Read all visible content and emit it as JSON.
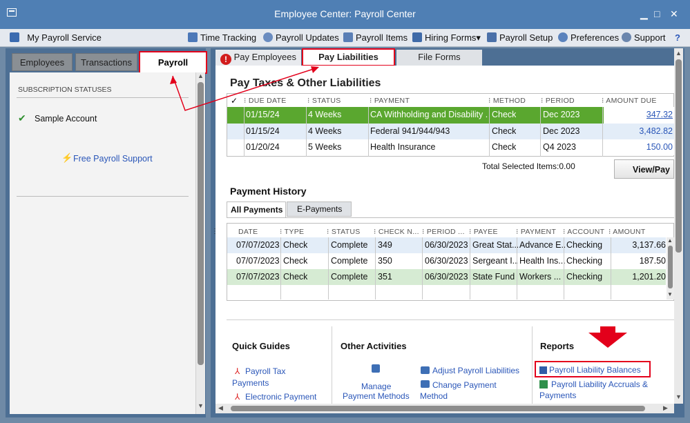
{
  "window": {
    "title": "Employee Center: Payroll Center",
    "min": "▁",
    "max": "□",
    "close": "✕"
  },
  "toolbar": {
    "my_payroll": "My Payroll Service",
    "time_tracking": "Time Tracking",
    "payroll_updates": "Payroll Updates",
    "payroll_items": "Payroll Items",
    "hiring_forms": "Hiring Forms▾",
    "payroll_setup": "Payroll Setup",
    "preferences": "Preferences",
    "support": "Support",
    "help": "?"
  },
  "left": {
    "tabs": [
      "Employees",
      "Transactions",
      "Payroll"
    ],
    "subscription_header": "SUBSCRIPTION STATUSES",
    "account": "Sample Account",
    "free_support": "Free Payroll Support"
  },
  "right": {
    "tabs": [
      "Pay Employees",
      "Pay Liabilities",
      "File Forms"
    ],
    "liabilities_title": "Pay Taxes & Other Liabilities",
    "liab_headers": [
      "✓",
      "DUE DATE",
      "STATUS",
      "PAYMENT",
      "METHOD",
      "PERIOD",
      "AMOUNT DUE"
    ],
    "liab_rows": [
      {
        "due": "01/15/24",
        "status": "4 Weeks",
        "payment": "CA Withholding and Disability ...",
        "method": "Check",
        "period": "Dec 2023",
        "amount": "347.32"
      },
      {
        "due": "01/15/24",
        "status": "4 Weeks",
        "payment": "Federal 941/944/943",
        "method": "Check",
        "period": "Dec 2023",
        "amount": "3,482.82"
      },
      {
        "due": "01/20/24",
        "status": "5 Weeks",
        "payment": "Health Insurance",
        "method": "Check",
        "period": "Q4 2023",
        "amount": "150.00"
      }
    ],
    "total_selected": "Total Selected Items:0.00",
    "view_pay": "View/Pay",
    "history_title": "Payment History",
    "history_tabs": [
      "All Payments",
      "E-Payments"
    ],
    "hist_headers": [
      "DATE",
      "TYPE",
      "STATUS",
      "CHECK N...",
      "PERIOD ...",
      "PAYEE",
      "PAYMENT",
      "ACCOUNT",
      "AMOUNT"
    ],
    "hist_rows": [
      {
        "date": "07/07/2023",
        "type": "Check",
        "status": "Complete",
        "check": "349",
        "period": "06/30/2023",
        "payee": "Great Stat...",
        "payment": "Advance E...",
        "account": "Checking",
        "amount": "3,137.66"
      },
      {
        "date": "07/07/2023",
        "type": "Check",
        "status": "Complete",
        "check": "350",
        "period": "06/30/2023",
        "payee": "Sergeant I...",
        "payment": "Health Ins...",
        "account": "Checking",
        "amount": "187.50"
      },
      {
        "date": "07/07/2023",
        "type": "Check",
        "status": "Complete",
        "check": "351",
        "period": "06/30/2023",
        "payee": "State Fund",
        "payment": "Workers ...",
        "account": "Checking",
        "amount": "1,201.20"
      }
    ],
    "quick_guides": {
      "title": "Quick Guides",
      "links": [
        "Payroll Tax",
        "Payments",
        "Electronic Payment"
      ]
    },
    "other_activities": {
      "title": "Other Activities",
      "manage": "Manage",
      "manage2": "Payment Methods",
      "adjust": "Adjust Payroll Liabilities",
      "change": "Change Payment",
      "change2": "Method"
    },
    "reports": {
      "title": "Reports",
      "balances": "Payroll Liability Balances",
      "accruals": "Payroll Liability Accruals &",
      "accruals2": "Payments"
    }
  },
  "colors": {
    "selected_row": "#5aa72f",
    "alt_row": "#e3edf8",
    "paid_row": "#d6ebd3",
    "highlight": "#e3001b"
  }
}
